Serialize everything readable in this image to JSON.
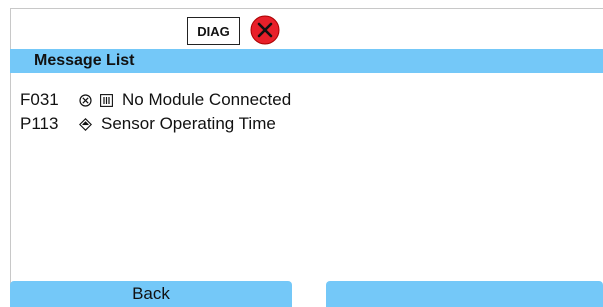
{
  "header": {
    "diag_label": "DIAG",
    "status_icon": "error-x-icon",
    "status_color": "#e8202a"
  },
  "title_bar": {
    "title": "Message List",
    "color": "#74c8f8"
  },
  "messages": [
    {
      "code": "F031",
      "icons": [
        "failure-circle-x-icon",
        "maintenance-bars-icon"
      ],
      "text": "No Module Connected"
    },
    {
      "code": "P113",
      "icons": [
        "check-diamond-icon"
      ],
      "text": "Sensor Operating Time"
    }
  ],
  "footer": {
    "left_label": "Back",
    "right_label": ""
  }
}
